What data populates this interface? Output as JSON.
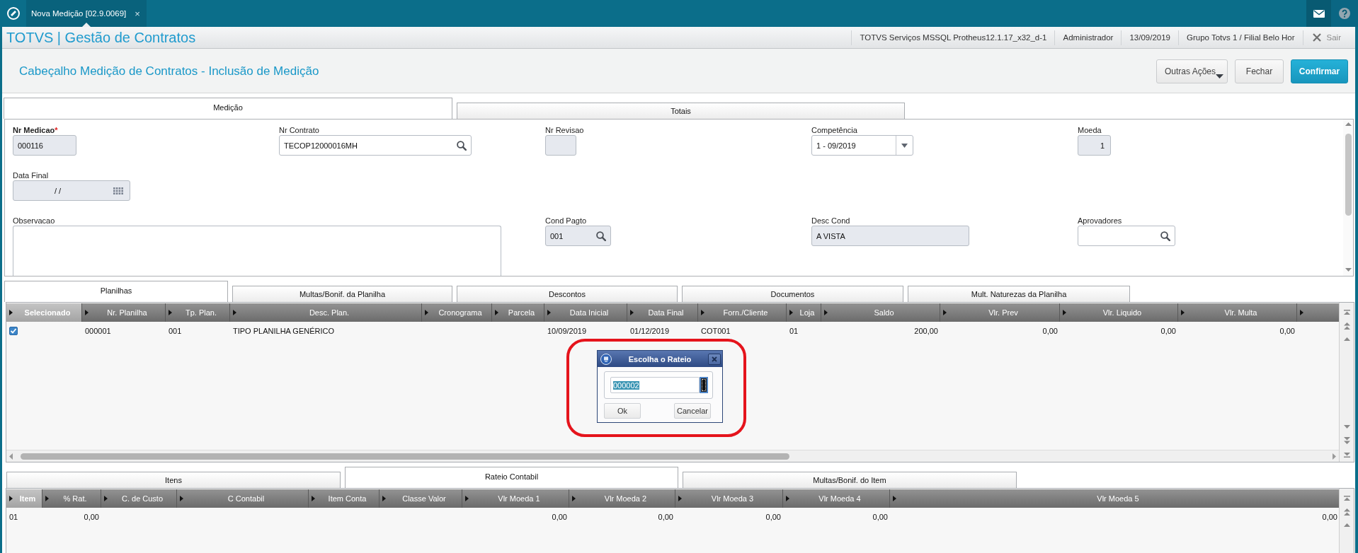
{
  "top_bar": {
    "tabs": [
      {
        "label": "Nova Medição [02.9.0069]",
        "close": "×",
        "selected": true
      }
    ]
  },
  "app_bar": {
    "title": "TOTVS | Gestão de Contratos",
    "info": [
      "TOTVS Serviços MSSQL Protheus12.1.17_x32_d-1",
      "Administrador",
      "13/09/2019",
      "Grupo Totvs 1 / Filial Belo Hor"
    ],
    "exit": "Sair"
  },
  "header": {
    "title": "Cabeçalho Medição de Contratos - Inclusão de Medição",
    "buttons": [
      {
        "label": "Outras Ações",
        "kind": "menu"
      },
      {
        "label": "Fechar",
        "kind": "secondary"
      },
      {
        "label": "Confirmar",
        "kind": "primary"
      }
    ]
  },
  "main_tabs": [
    {
      "label": "Medição",
      "selected": true
    },
    {
      "label": "Totais",
      "selected": false
    }
  ],
  "form": {
    "rows": [
      [
        {
          "label": "Nr Medicao",
          "mark": "*",
          "required": true,
          "kind": "text",
          "value": "000116",
          "disabled": true
        },
        {
          "label": "Nr Contrato",
          "required": false,
          "kind": "lookup",
          "value": "TECOP12000016MH",
          "disabled": false
        },
        {
          "label": "Nr Revisao",
          "required": false,
          "kind": "text",
          "disabled": true
        },
        {
          "label": "Competência",
          "required": false,
          "kind": "combo",
          "value": "1 - 09/2019",
          "disabled": false
        },
        {
          "label": "Moeda",
          "required": false,
          "kind": "number",
          "value": "1",
          "disabled": true
        }
      ],
      [
        {
          "label": "Data Final",
          "required": false,
          "kind": "date",
          "value": "/ /",
          "disabled": true
        }
      ],
      [
        {
          "label": "Observacao",
          "required": false,
          "kind": "memo",
          "disabled": false
        },
        null,
        {
          "label": "Cond Pagto",
          "required": false,
          "kind": "lookup",
          "value": "001",
          "disabled": true
        },
        {
          "label": "Desc Cond",
          "required": false,
          "kind": "text",
          "value": "A VISTA",
          "disabled": true
        },
        {
          "label": "Aprovadores",
          "required": false,
          "kind": "lookup",
          "disabled": false
        }
      ]
    ]
  },
  "detail_tabs": [
    {
      "label": "Planilhas",
      "selected": true
    },
    {
      "label": "Multas/Bonif. da Planilha",
      "selected": false
    },
    {
      "label": "Descontos",
      "selected": false
    },
    {
      "label": "Documentos",
      "selected": false
    },
    {
      "label": "Mult. Naturezas da Planilha",
      "selected": false
    }
  ],
  "planilhas_grid": {
    "columns": [
      {
        "label": "Selecionado",
        "kind": "check",
        "selected": true
      },
      {
        "label": "Nr. Planilha",
        "kind": "text",
        "selected": false
      },
      {
        "label": "Tp. Plan.",
        "kind": "text",
        "selected": false
      },
      {
        "label": "Desc. Plan.",
        "kind": "text",
        "selected": false
      },
      {
        "label": "Cronograma",
        "kind": "text",
        "selected": false
      },
      {
        "label": "Parcela",
        "kind": "text",
        "selected": false
      },
      {
        "label": "Data Inicial",
        "kind": "text",
        "selected": false
      },
      {
        "label": "Data Final",
        "kind": "text",
        "selected": false
      },
      {
        "label": "Forn./Cliente",
        "kind": "text",
        "selected": false
      },
      {
        "label": "Loja",
        "kind": "text",
        "selected": false
      },
      {
        "label": "Saldo",
        "kind": "number",
        "selected": false
      },
      {
        "label": "Vlr. Prev",
        "kind": "number",
        "selected": false
      },
      {
        "label": "Vlr. Liquido",
        "kind": "number",
        "selected": false
      },
      {
        "label": "Vlr. Multa",
        "kind": "number",
        "selected": false
      },
      {
        "kind": "text",
        "selected": false
      }
    ],
    "rows": [
      {
        "cells": [
          {
            "checked": true
          },
          "000001",
          "001",
          "TIPO PLANILHA GENÉRICO",
          null,
          null,
          "10/09/2019",
          "01/12/2019",
          "COT001",
          "01",
          "200,00",
          "0,00",
          "0,00",
          "0,00",
          null
        ]
      }
    ]
  },
  "item_tabs": [
    {
      "label": "Itens",
      "selected": false
    },
    {
      "label": "Rateio Contabil",
      "selected": true
    },
    {
      "label": "Multas/Bonif. do Item",
      "selected": false
    }
  ],
  "rateio_grid": {
    "columns": [
      {
        "label": "Item",
        "kind": "text",
        "selected": true
      },
      {
        "label": "% Rat.",
        "kind": "number",
        "selected": false
      },
      {
        "label": "C. de Custo",
        "kind": "text",
        "selected": false
      },
      {
        "label": "C Contabil",
        "kind": "text",
        "selected": false
      },
      {
        "label": "Item Conta",
        "kind": "text",
        "selected": false
      },
      {
        "label": "Classe Valor",
        "kind": "text",
        "selected": false
      },
      {
        "label": "Vlr Moeda 1",
        "kind": "number",
        "selected": false
      },
      {
        "label": "Vlr Moeda 2",
        "kind": "number",
        "selected": false
      },
      {
        "label": "Vlr Moeda 3",
        "kind": "number",
        "selected": false
      },
      {
        "label": "Vlr Moeda 4",
        "kind": "number",
        "selected": false
      },
      {
        "label": "Vlr Moeda 5",
        "kind": "number",
        "selected": false
      }
    ],
    "rows": [
      {
        "cells": [
          "01",
          "0,00",
          null,
          null,
          null,
          null,
          "0,00",
          "0,00",
          "0,00",
          "0,00",
          "0,00"
        ]
      }
    ]
  },
  "dialog": {
    "title": "Escolha o Rateio",
    "value": "000002",
    "value_selected": true,
    "buttons": [
      "Ok",
      "Cancelar"
    ]
  },
  "annotations": [
    {
      "kind": "ring"
    }
  ]
}
